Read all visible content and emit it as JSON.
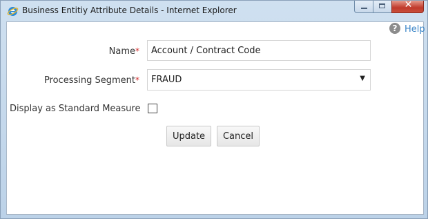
{
  "window": {
    "title": "Business Entitiy Attribute Details - Internet Explorer",
    "close_glyph": "✕"
  },
  "help": {
    "icon_glyph": "?",
    "label": "Help"
  },
  "form": {
    "name": {
      "label": "Name",
      "required_marker": "*",
      "value": "Account / Contract Code"
    },
    "processing_segment": {
      "label": "Processing Segment",
      "required_marker": "*",
      "selected": "FRAUD",
      "arrow_glyph": "▼"
    },
    "display_as_standard_measure": {
      "label": "Display as Standard Measure",
      "checked": false
    }
  },
  "buttons": {
    "update": "Update",
    "cancel": "Cancel"
  },
  "colors": {
    "title_bar": "#c4d8ec",
    "close_button": "#c0392b",
    "help_link": "#3c86c8",
    "required_marker": "#d22b2b"
  },
  "icons": {
    "browser": "internet-explorer-icon",
    "help": "help-circle-icon",
    "dropdown": "chevron-down-icon"
  }
}
